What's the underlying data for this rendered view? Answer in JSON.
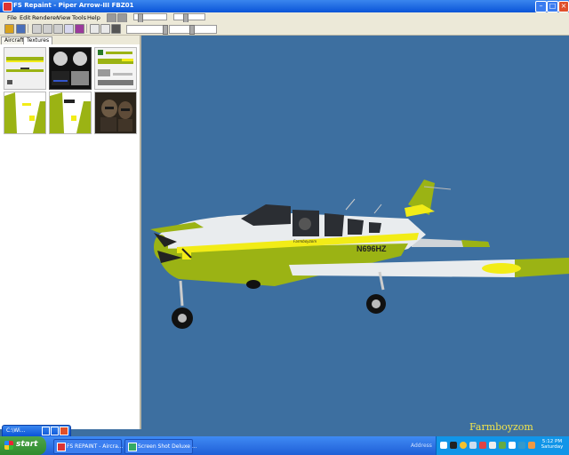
{
  "window": {
    "title": "FS Repaint - Piper Arrow-III FBZ01"
  },
  "menu": [
    "File",
    "Edit",
    "Renderer",
    "View",
    "Tools",
    "Help"
  ],
  "tabs": [
    "Aircraft",
    "Textures"
  ],
  "aircraft": {
    "registration": "N696HZ",
    "cabin_script": "Farmboyzom"
  },
  "watermark": "Farmboyzom",
  "minimized_window": {
    "title": "C:\\Wi..."
  },
  "taskbar": {
    "start_label": "start",
    "tasks": [
      "FS REPAINT - Aircra...",
      "Screen Shot Deluxe ..."
    ],
    "address_label": "Address",
    "clock_time": "5:12 PM",
    "clock_day": "Saturday"
  },
  "colors": {
    "sky": "#3d6fa0",
    "livery_green": "#9bb314",
    "livery_yellow": "#f2ec17",
    "taskbar": "#245edb"
  }
}
